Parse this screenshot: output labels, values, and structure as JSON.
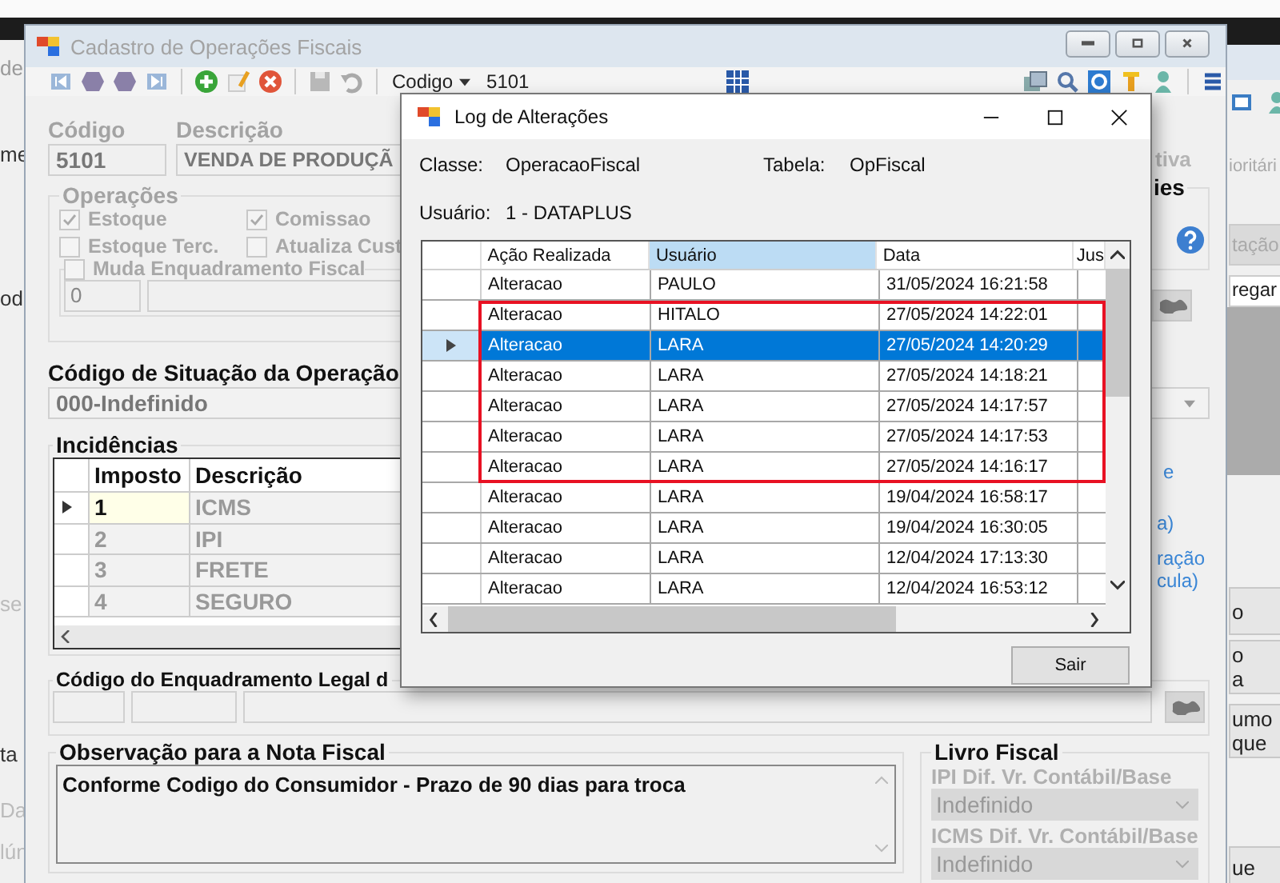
{
  "left_window": {
    "fragments": [
      "de",
      "me",
      "od",
      "se",
      "ta",
      "Da",
      "lún"
    ]
  },
  "main_window": {
    "title": "Cadastro de Operações Fiscais",
    "toolbar": {
      "search_label": "Codigo",
      "search_value": "5101"
    },
    "codigo": {
      "label": "Código",
      "value": "5101"
    },
    "descricao": {
      "label": "Descrição",
      "value": "VENDA DE PRODUÇÃ"
    },
    "operacoes": {
      "title": "Operações",
      "options": [
        {
          "label": "Estoque",
          "checked": true
        },
        {
          "label": "Comissao",
          "checked": true
        },
        {
          "label": "Estoque Terc.",
          "checked": false
        },
        {
          "label": "Atualiza Cust",
          "checked": false
        }
      ],
      "muda": {
        "label": "Muda Enquadramento Fiscal",
        "checked": false
      },
      "value": "0"
    },
    "cst": {
      "title": "Código de Situação da Operação",
      "value": "000-Indefinido"
    },
    "incidencias": {
      "title": "Incidências",
      "columns": [
        "Imposto",
        "Descrição"
      ],
      "rows": [
        {
          "imposto": "1",
          "descricao": "ICMS",
          "selected": true
        },
        {
          "imposto": "2",
          "descricao": "IPI",
          "selected": false
        },
        {
          "imposto": "3",
          "descricao": "FRETE",
          "selected": false
        },
        {
          "imposto": "4",
          "descricao": "SEGURO",
          "selected": false
        }
      ]
    },
    "enquadramento": {
      "title": "Código do Enquadramento Legal d"
    },
    "observacao": {
      "title": "Observação para a Nota Fiscal",
      "value": "Conforme Codigo do Consumidor - Prazo de 90 dias para troca"
    },
    "right_panel": {
      "label": "tiva",
      "group_title": "ies",
      "links": [
        "e",
        "a)",
        "ração",
        "cula)"
      ]
    },
    "livro_fiscal": {
      "title": "Livro Fiscal",
      "fields": [
        {
          "label": "IPI Dif. Vr. Contábil/Base",
          "value": "Indefinido"
        },
        {
          "label": "ICMS Dif. Vr. Contábil/Base",
          "value": "Indefinido"
        }
      ]
    }
  },
  "right_window": {
    "label": "ioritári",
    "buttons": [
      "tação",
      "regar"
    ],
    "lower_buttons": [
      "o",
      "o\na",
      "umo\nque",
      "ue"
    ]
  },
  "dialog": {
    "title": "Log de Alterações",
    "classe_label": "Classe:",
    "classe": "OperacaoFiscal",
    "tabela_label": "Tabela:",
    "tabela": "OpFiscal",
    "usuario_label": "Usuário:",
    "usuario": "1 - DATAPLUS",
    "columns": [
      {
        "label": "Ação Realizada",
        "selected": false
      },
      {
        "label": "Usuário",
        "selected": true
      },
      {
        "label": "Data",
        "selected": false
      },
      {
        "label": "Jus",
        "selected": false
      }
    ],
    "rows": [
      {
        "acao": "Alteracao",
        "usuario": "PAULO",
        "data": "31/05/2024 16:21:58",
        "selected": false,
        "highlighted": false
      },
      {
        "acao": "Alteracao",
        "usuario": "HITALO",
        "data": "27/05/2024 14:22:01",
        "selected": false,
        "highlighted": true
      },
      {
        "acao": "Alteracao",
        "usuario": "LARA",
        "data": "27/05/2024 14:20:29",
        "selected": true,
        "highlighted": true
      },
      {
        "acao": "Alteracao",
        "usuario": "LARA",
        "data": "27/05/2024 14:18:21",
        "selected": false,
        "highlighted": true
      },
      {
        "acao": "Alteracao",
        "usuario": "LARA",
        "data": "27/05/2024 14:17:57",
        "selected": false,
        "highlighted": true
      },
      {
        "acao": "Alteracao",
        "usuario": "LARA",
        "data": "27/05/2024 14:17:53",
        "selected": false,
        "highlighted": true
      },
      {
        "acao": "Alteracao",
        "usuario": "LARA",
        "data": "27/05/2024 14:16:17",
        "selected": false,
        "highlighted": true
      },
      {
        "acao": "Alteracao",
        "usuario": "LARA",
        "data": "19/04/2024 16:58:17",
        "selected": false,
        "highlighted": false
      },
      {
        "acao": "Alteracao",
        "usuario": "LARA",
        "data": "19/04/2024 16:30:05",
        "selected": false,
        "highlighted": false
      },
      {
        "acao": "Alteracao",
        "usuario": "LARA",
        "data": "12/04/2024 17:13:30",
        "selected": false,
        "highlighted": false
      },
      {
        "acao": "Alteracao",
        "usuario": "LARA",
        "data": "12/04/2024 16:53:12",
        "selected": false,
        "highlighted": false
      }
    ],
    "button": "Sair"
  }
}
